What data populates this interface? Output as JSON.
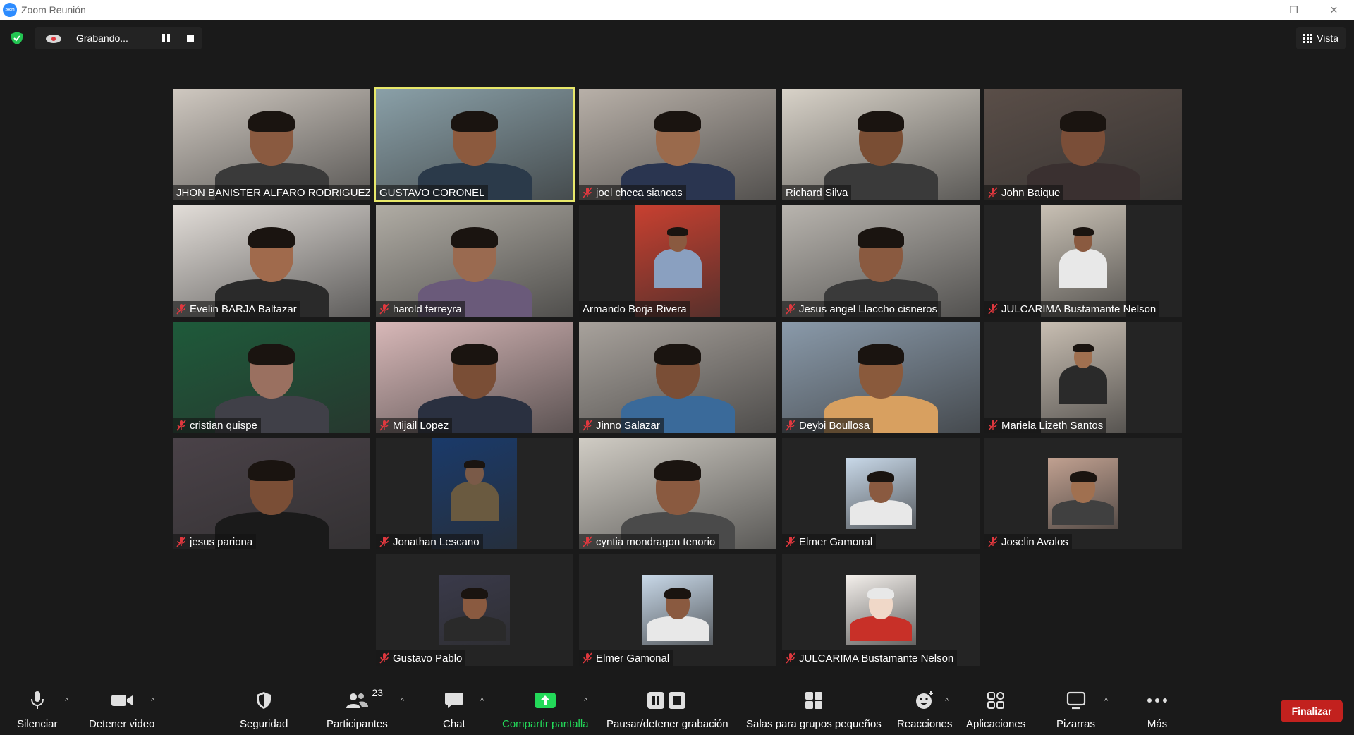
{
  "window": {
    "title": "Zoom Reunión",
    "logo_text": "zoom",
    "controls": [
      "—",
      "❐",
      "✕"
    ]
  },
  "topbar": {
    "recording_label": "Grabando...",
    "view_label": "Vista"
  },
  "participants": [
    {
      "name": "JHON BANISTER ALFARO RODRIGUEZ",
      "muted": false,
      "bg": "#cfc8c0",
      "skin": "#8a5a40",
      "shirt": "#3a3a3a"
    },
    {
      "name": "GUSTAVO CORONEL",
      "muted": false,
      "bg": "#8aa0a8",
      "skin": "#8c5a3e",
      "shirt": "#2b3a4a",
      "active": true
    },
    {
      "name": "joel checa siancas",
      "muted": true,
      "bg": "#b8b0a8",
      "skin": "#9a6a4c",
      "shirt": "#2a3550"
    },
    {
      "name": "Richard Silva",
      "muted": false,
      "bg": "#d8d2c8",
      "skin": "#7a4e34",
      "shirt": "#3a3a3a"
    },
    {
      "name": "John Baique",
      "muted": true,
      "bg": "#5a4e48",
      "skin": "#7a4e38",
      "shirt": "#3a3030"
    },
    {
      "name": "Evelin BARJA  Baltazar",
      "muted": true,
      "bg": "#e2ddd8",
      "skin": "#a06a4c",
      "shirt": "#2a2a2a"
    },
    {
      "name": "harold ferreyra",
      "muted": true,
      "bg": "#b0aca4",
      "skin": "#9a6a50",
      "shirt": "#6a5a7a"
    },
    {
      "name": "Armando Borja Rivera",
      "muted": false,
      "bg": "#c84030",
      "skin": "#8a5a40",
      "shirt": "#8aa0c0",
      "narrow": true
    },
    {
      "name": "Jesus angel Llaccho cisneros",
      "muted": true,
      "bg": "#b8b4ae",
      "skin": "#8a5a40",
      "shirt": "#3a3a3a"
    },
    {
      "name": "JULCARIMA Bustamante Nelson",
      "muted": true,
      "bg": "#c8c0b4",
      "skin": "#8a5a40",
      "shirt": "#e8e8e8",
      "narrow": true
    },
    {
      "name": "cristian quispe",
      "muted": true,
      "bg": "#1e5a3a",
      "skin": "#9a7060",
      "shirt": "#404048"
    },
    {
      "name": "Mijail Lopez",
      "muted": true,
      "bg": "#d8b8b8",
      "skin": "#7a4e36",
      "shirt": "#2a3040"
    },
    {
      "name": "Jinno Salazar",
      "muted": true,
      "bg": "#a8a29c",
      "skin": "#7a4e36",
      "shirt": "#3a6a9a"
    },
    {
      "name": "Deybi Boullosa",
      "muted": true,
      "bg": "#8a9aaa",
      "skin": "#8a5a3c",
      "shirt": "#d8a060"
    },
    {
      "name": "Mariela Lizeth Santos",
      "muted": true,
      "bg": "#c8beb2",
      "skin": "#a07050",
      "shirt": "#2a2a2a",
      "narrow": true
    },
    {
      "name": "jesus pariona",
      "muted": true,
      "bg": "#4a4248",
      "skin": "#7a4e36",
      "shirt": "#1a1a1a"
    },
    {
      "name": "Jonathan Lescano",
      "muted": true,
      "bg": "#1a3a6a",
      "skin": "#7a5a48",
      "shirt": "#6a5a40",
      "narrow": true
    },
    {
      "name": "cyntia mondragon tenorio",
      "muted": true,
      "bg": "#d0ccc4",
      "skin": "#8a5a40",
      "shirt": "#4a4a4a"
    },
    {
      "name": "Elmer Gamonal",
      "muted": true,
      "bg": "#c8d8e8",
      "skin": "#8a5a40",
      "shirt": "#e8e8e8",
      "photo": true
    },
    {
      "name": "Joselin Avalos",
      "muted": true,
      "bg": "#c0a090",
      "skin": "#a07050",
      "shirt": "#404040",
      "photo": true
    },
    {
      "name": "Gustavo Pablo",
      "muted": true,
      "bg": "#3a3a4a",
      "skin": "#8a5a40",
      "shirt": "#2a2a2a",
      "photo": true
    },
    {
      "name": "Elmer Gamonal",
      "muted": true,
      "bg": "#c8d8e8",
      "skin": "#8a5a40",
      "shirt": "#e8e8e8",
      "photo": true
    },
    {
      "name": "JULCARIMA Bustamante Nelson",
      "muted": true,
      "bg": "#f4f0ec",
      "skin": "#f0d8c8",
      "shirt": "#c83028",
      "photo": true,
      "anime": true
    }
  ],
  "toolbar": {
    "mute_label": "Silenciar",
    "video_label": "Detener video",
    "security_label": "Seguridad",
    "participants_label": "Participantes",
    "participants_count": "23",
    "chat_label": "Chat",
    "share_label": "Compartir pantalla",
    "record_label": "Pausar/detener grabación",
    "breakout_label": "Salas para grupos pequeños",
    "reactions_label": "Reacciones",
    "apps_label": "Aplicaciones",
    "whiteboard_label": "Pizarras",
    "more_label": "Más",
    "end_label": "Finalizar"
  },
  "colors": {
    "active_speaker": "#e8e86a",
    "end_button": "#c2211e",
    "share_green": "#23d959",
    "muted_red": "#e0383e",
    "shield_green": "#23c552"
  }
}
